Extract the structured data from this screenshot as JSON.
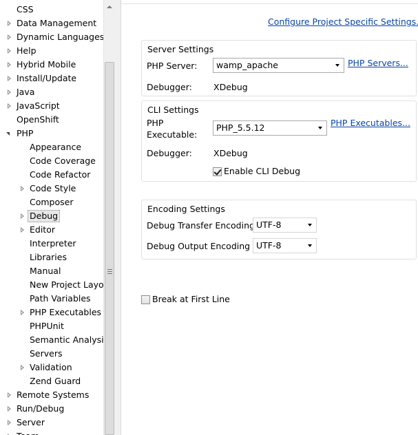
{
  "tree": {
    "items": [
      {
        "label": "CSS",
        "twisty": "none",
        "level": 0
      },
      {
        "label": "Data Management",
        "twisty": "closed",
        "level": 0
      },
      {
        "label": "Dynamic Languages",
        "twisty": "closed",
        "level": 0
      },
      {
        "label": "Help",
        "twisty": "closed",
        "level": 0
      },
      {
        "label": "Hybrid Mobile",
        "twisty": "closed",
        "level": 0
      },
      {
        "label": "Install/Update",
        "twisty": "closed",
        "level": 0
      },
      {
        "label": "Java",
        "twisty": "closed",
        "level": 0
      },
      {
        "label": "JavaScript",
        "twisty": "closed",
        "level": 0
      },
      {
        "label": "OpenShift",
        "twisty": "none",
        "level": 0
      },
      {
        "label": "PHP",
        "twisty": "open",
        "level": 0
      },
      {
        "label": "Appearance",
        "twisty": "none",
        "level": 1
      },
      {
        "label": "Code Coverage",
        "twisty": "none",
        "level": 1
      },
      {
        "label": "Code Refactor",
        "twisty": "none",
        "level": 1
      },
      {
        "label": "Code Style",
        "twisty": "closed",
        "level": 1
      },
      {
        "label": "Composer",
        "twisty": "none",
        "level": 1
      },
      {
        "label": "Debug",
        "twisty": "closed",
        "level": 1,
        "selected": true
      },
      {
        "label": "Editor",
        "twisty": "closed",
        "level": 1
      },
      {
        "label": "Interpreter",
        "twisty": "none",
        "level": 1
      },
      {
        "label": "Libraries",
        "twisty": "none",
        "level": 1
      },
      {
        "label": "Manual",
        "twisty": "none",
        "level": 1
      },
      {
        "label": "New Project Layout",
        "twisty": "none",
        "level": 1
      },
      {
        "label": "Path Variables",
        "twisty": "none",
        "level": 1
      },
      {
        "label": "PHP Executables",
        "twisty": "closed",
        "level": 1
      },
      {
        "label": "PHPUnit",
        "twisty": "none",
        "level": 1
      },
      {
        "label": "Semantic Analysis",
        "twisty": "none",
        "level": 1
      },
      {
        "label": "Servers",
        "twisty": "none",
        "level": 1
      },
      {
        "label": "Validation",
        "twisty": "closed",
        "level": 1
      },
      {
        "label": "Zend Guard",
        "twisty": "none",
        "level": 1
      },
      {
        "label": "Remote Systems",
        "twisty": "closed",
        "level": 0
      },
      {
        "label": "Run/Debug",
        "twisty": "closed",
        "level": 0
      },
      {
        "label": "Server",
        "twisty": "closed",
        "level": 0
      },
      {
        "label": "Team",
        "twisty": "closed",
        "level": 0
      }
    ]
  },
  "configure_link": "Configure Project Specific Settings...",
  "server_settings": {
    "title": "Server Settings",
    "php_server_label": "PHP Server:",
    "php_server_value": "wamp_apache",
    "php_servers_link": "PHP Servers...",
    "debugger_label": "Debugger:",
    "debugger_value": "XDebug"
  },
  "cli_settings": {
    "title": "CLI Settings",
    "php_executable_label_line1": "PHP",
    "php_executable_label_line2": "Executable:",
    "php_executable_value": "PHP_5.5.12",
    "php_executables_link": "PHP Executables...",
    "debugger_label": "Debugger:",
    "debugger_value": "XDebug",
    "enable_cli_debug_label": "Enable CLI Debug",
    "enable_cli_debug_checked": true
  },
  "encoding_settings": {
    "title": "Encoding Settings",
    "transfer_label": "Debug Transfer Encoding",
    "transfer_value": "UTF-8",
    "output_label": "Debug Output Encoding",
    "output_value": "UTF-8"
  },
  "break_at_first_line": {
    "label": "Break at First Line",
    "checked": false
  }
}
